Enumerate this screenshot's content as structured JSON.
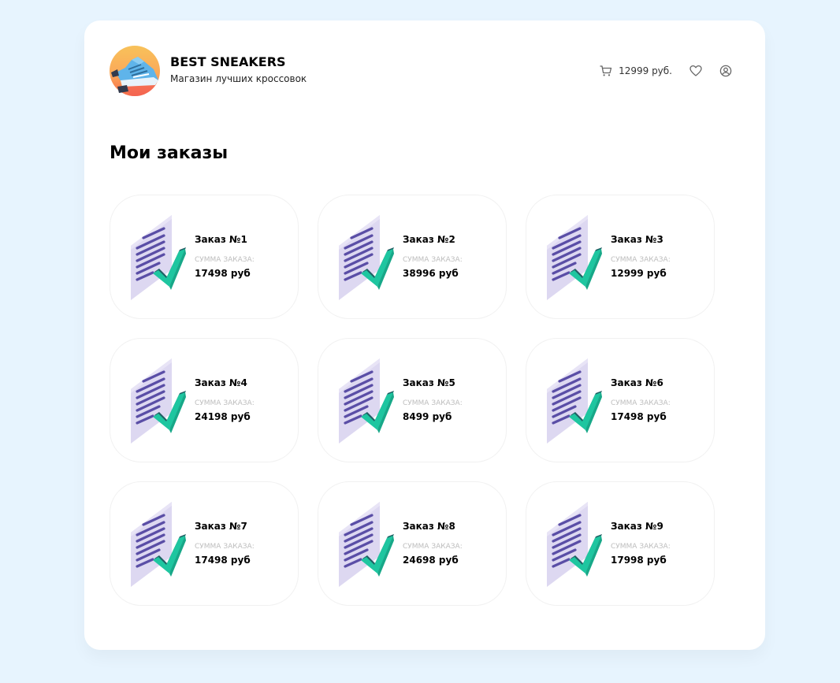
{
  "header": {
    "brand_title": "BEST SNEAKERS",
    "brand_subtitle": "Магазин лучших кроссовок",
    "cart_total": "12999 руб."
  },
  "icons": {
    "logo": "sneaker-logo-icon",
    "cart": "cart-icon",
    "favorites": "heart-icon",
    "profile": "user-icon",
    "order": "document-check-icon"
  },
  "colors": {
    "background": "#e7f4fe",
    "doc_paper": "#ddd8f1",
    "doc_lines": "#5a4ea6",
    "check": "#1ec6a0"
  },
  "main": {
    "title": "Мои заказы",
    "orders": [
      {
        "title": "Заказ №1",
        "sum_label": "Сумма заказа:",
        "sum": "17498 руб"
      },
      {
        "title": "Заказ №2",
        "sum_label": "Сумма заказа:",
        "sum": "38996 руб"
      },
      {
        "title": "Заказ №3",
        "sum_label": "Сумма заказа:",
        "sum": "12999 руб"
      },
      {
        "title": "Заказ №4",
        "sum_label": "Сумма заказа:",
        "sum": "24198 руб"
      },
      {
        "title": "Заказ №5",
        "sum_label": "Сумма заказа:",
        "sum": "8499 руб"
      },
      {
        "title": "Заказ №6",
        "sum_label": "Сумма заказа:",
        "sum": "17498 руб"
      },
      {
        "title": "Заказ №7",
        "sum_label": "Сумма заказа:",
        "sum": "17498 руб"
      },
      {
        "title": "Заказ №8",
        "sum_label": "Сумма заказа:",
        "sum": "24698 руб"
      },
      {
        "title": "Заказ №9",
        "sum_label": "Сумма заказа:",
        "sum": "17998 руб"
      }
    ]
  }
}
